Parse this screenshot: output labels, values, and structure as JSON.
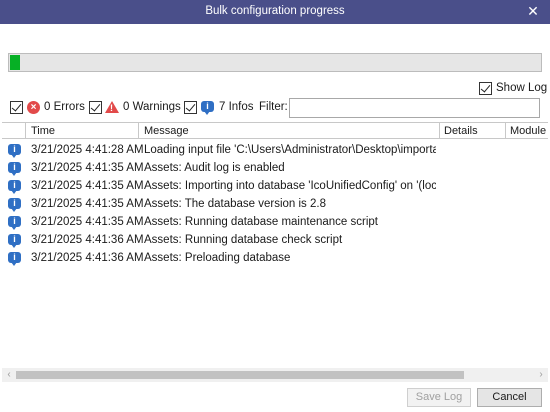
{
  "window": {
    "title": "Bulk configuration progress",
    "close_glyph": "✕"
  },
  "progress": {
    "fraction": 0.018,
    "color": "#06b025"
  },
  "show_log": {
    "label": "Show Log",
    "checked": true
  },
  "filters": {
    "errors": {
      "label": "0 Errors",
      "checked": true,
      "icon": "error-icon"
    },
    "warnings": {
      "label": "0 Warnings",
      "checked": true,
      "icon": "warning-icon"
    },
    "infos": {
      "label": "7 Infos",
      "checked": true,
      "icon": "info-icon"
    },
    "filter_label": "Filter:",
    "filter_value": ""
  },
  "table": {
    "columns": [
      "Time",
      "Message",
      "Details",
      "Module"
    ],
    "rows": [
      {
        "time": "3/21/2025 4:41:28 AM",
        "message": "Loading input file 'C:\\Users\\Administrator\\Desktop\\importacm.x"
      },
      {
        "time": "3/21/2025 4:41:35 AM",
        "message": "Assets: Audit log is enabled"
      },
      {
        "time": "3/21/2025 4:41:35 AM",
        "message": "Assets: Importing into database 'IcoUnifiedConfig' on '(local)\\SC"
      },
      {
        "time": "3/21/2025 4:41:35 AM",
        "message": "Assets: The database version is 2.8"
      },
      {
        "time": "3/21/2025 4:41:35 AM",
        "message": "Assets: Running database maintenance script"
      },
      {
        "time": "3/21/2025 4:41:36 AM",
        "message": "Assets: Running database check script"
      },
      {
        "time": "3/21/2025 4:41:36 AM",
        "message": "Assets: Preloading database"
      }
    ]
  },
  "buttons": {
    "save_log": "Save Log",
    "cancel": "Cancel"
  },
  "icons": {
    "info_glyph": "i",
    "error_glyph": "×",
    "warning_glyph": "!",
    "scroll_left": "‹",
    "scroll_right": "›"
  }
}
